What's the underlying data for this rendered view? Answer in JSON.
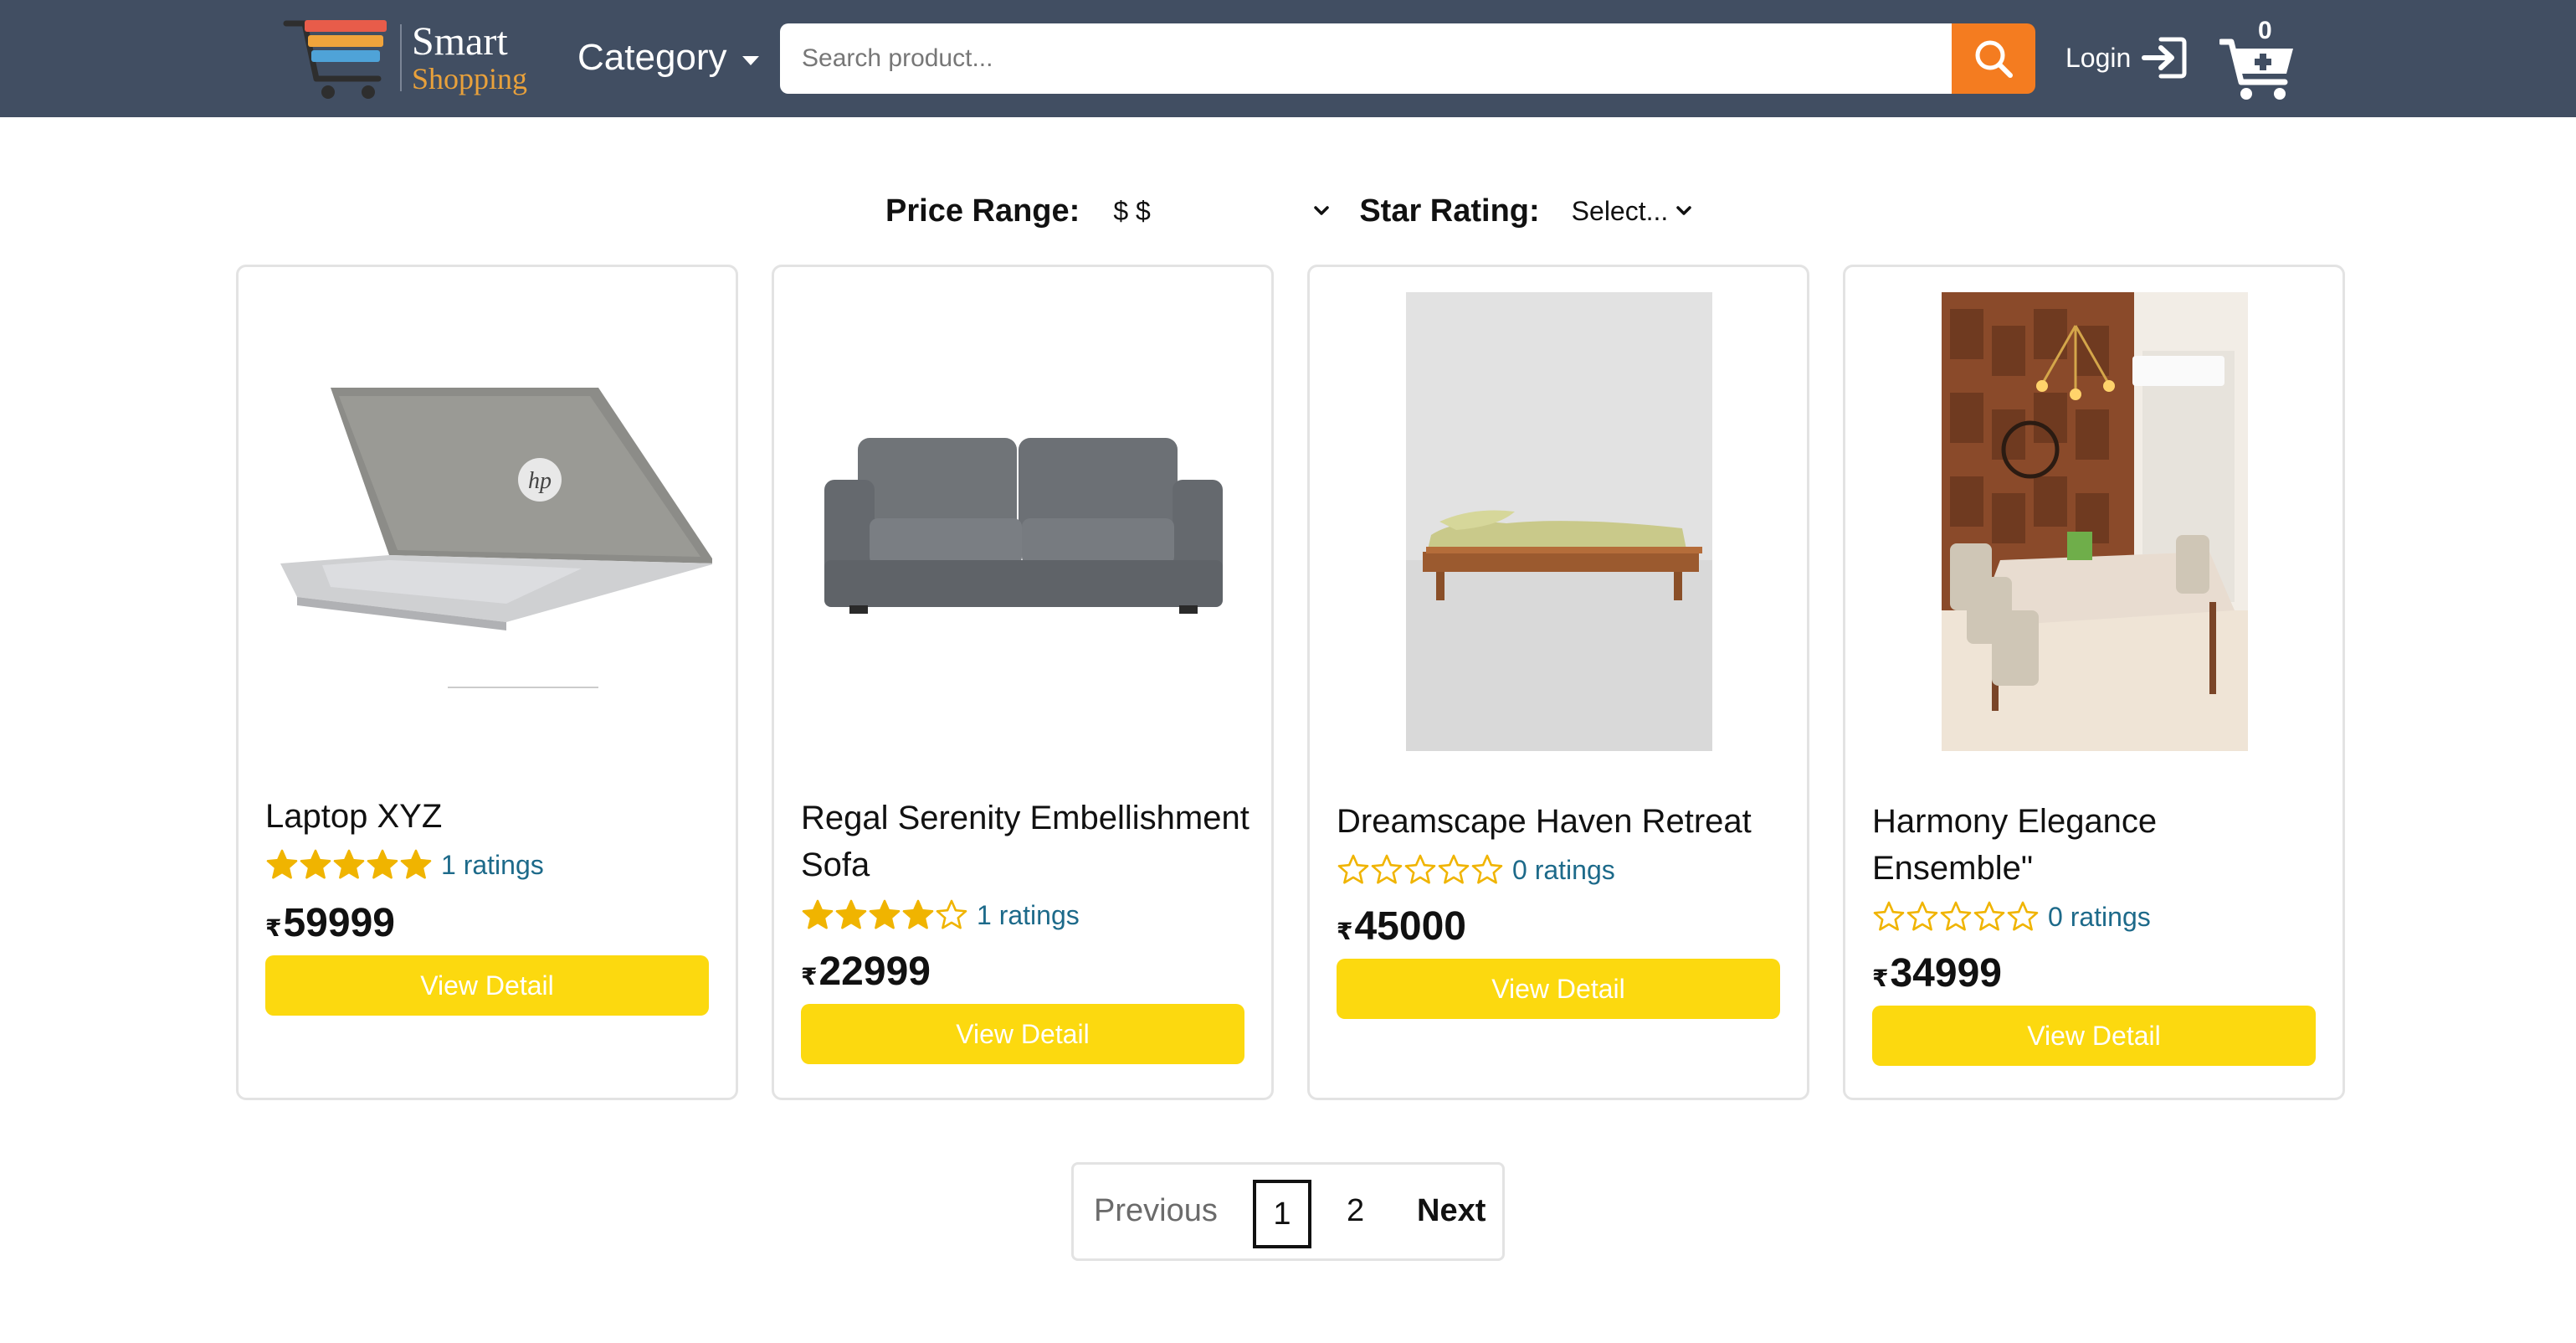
{
  "brand": {
    "line1": "Smart",
    "line2": "Shopping",
    "accent": "#e9a13b"
  },
  "header": {
    "background": "#414e62",
    "category_label": "Category",
    "search_placeholder": "Search product...",
    "search_button_color": "#f47c20",
    "login_label": "Login",
    "cart_count": "0"
  },
  "filters": {
    "price_label": "Price Range:",
    "price_value": "$ $",
    "star_label": "Star Rating:",
    "star_value": "Select..."
  },
  "products": [
    {
      "title": "Laptop XYZ",
      "stars": 5,
      "ratings_text": "1 ratings",
      "currency": "₹",
      "price": "59999",
      "button": "View Detail",
      "image": "laptop"
    },
    {
      "title": "Regal Serenity Embellishment Sofa",
      "stars": 4,
      "ratings_text": "1 ratings",
      "currency": "₹",
      "price": "22999",
      "button": "View Detail",
      "image": "sofa"
    },
    {
      "title": "Dreamscape Haven Retreat",
      "stars": 0,
      "ratings_text": "0 ratings",
      "currency": "₹",
      "price": "45000",
      "button": "View Detail",
      "image": "bed"
    },
    {
      "title": "Harmony Elegance Ensemble\"",
      "stars": 0,
      "ratings_text": "0 ratings",
      "currency": "₹",
      "price": "34999",
      "button": "View Detail",
      "image": "dining-room"
    }
  ],
  "pagination": {
    "previous": "Previous",
    "page1": "1",
    "page2": "2",
    "next": "Next",
    "current_page": 1
  },
  "colors": {
    "star": "#f0b400",
    "button": "#fcd90f",
    "ratings_link": "#1d6a8a"
  }
}
